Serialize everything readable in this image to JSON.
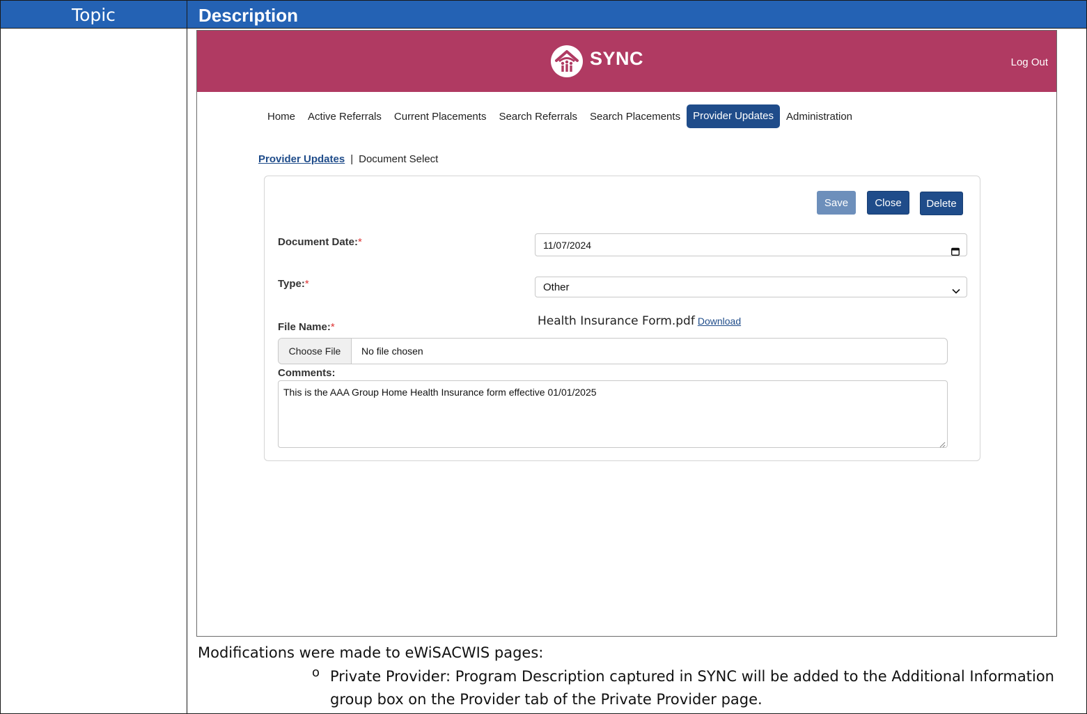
{
  "document": {
    "header_topic": "Topic",
    "header_description": "Description",
    "modifications_intro": "Modifications were made to eWiSACWIS pages:",
    "bullet_marker": "o",
    "bullet_text": "Private Provider: Program Description captured in SYNC will be added to the Additional Information group box on the Provider tab of the Private Provider page."
  },
  "app": {
    "brand": "SYNC",
    "logout_label": "Log Out",
    "colors": {
      "header_bg": "#b03a62",
      "accent": "#1f4c8a",
      "required": "#d33333"
    },
    "nav": [
      {
        "label": "Home",
        "active": false
      },
      {
        "label": "Active Referrals",
        "active": false
      },
      {
        "label": "Current Placements",
        "active": false
      },
      {
        "label": "Search Referrals",
        "active": false
      },
      {
        "label": "Search Placements",
        "active": false
      },
      {
        "label": "Provider Updates",
        "active": true
      },
      {
        "label": "Administration",
        "active": false
      }
    ],
    "breadcrumb": {
      "link": "Provider Updates",
      "separator": "|",
      "current": "Document Select"
    },
    "form": {
      "buttons": {
        "save": "Save",
        "close": "Close",
        "delete": "Delete"
      },
      "document_date_label": "Document Date:",
      "document_date_value": "11/07/2024",
      "type_label": "Type:",
      "type_value": "Other",
      "file_name_label": "File Name:",
      "current_file": "Health Insurance Form.pdf",
      "download_label": "Download",
      "choose_file_label": "Choose File",
      "file_status": "No file chosen",
      "comments_label": "Comments:",
      "comments_value": "This is the AAA Group Home Health Insurance form effective 01/01/2025",
      "required_marker": "*"
    },
    "icons": [
      "sync-logo-icon",
      "calendar-icon",
      "chevron-down-icon",
      "resize-handle-icon"
    ]
  }
}
